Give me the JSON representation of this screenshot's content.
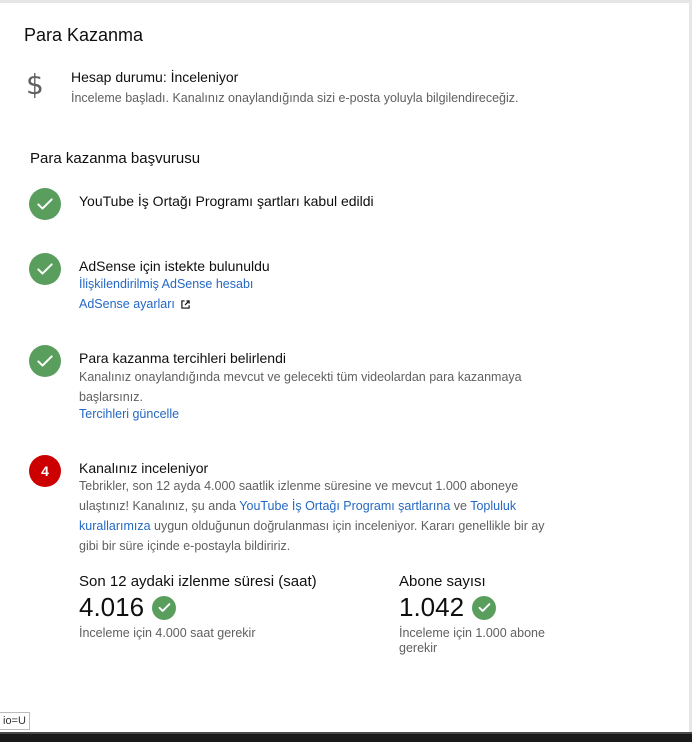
{
  "page": {
    "title": "Para Kazanma"
  },
  "account_status": {
    "icon": "dollar-icon",
    "title": "Hesap durumu: İnceleniyor",
    "description": "İnceleme başladı. Kanalınız onaylandığında sizi e-posta yoluyla bilgilendireceğiz."
  },
  "application": {
    "title": "Para kazanma başvurusu",
    "steps": [
      {
        "status": "done",
        "title": "YouTube İş Ortağı Programı şartları kabul edildi"
      },
      {
        "status": "done",
        "title": "AdSense için istekte bulunuldu",
        "link1": "İlişkilendirilmiş AdSense hesabı",
        "link2": "AdSense ayarları"
      },
      {
        "status": "done",
        "title": "Para kazanma tercihleri belirlendi",
        "description": "Kanalınız onaylandığında mevcut ve gelecekti tüm videolardan para kazanmaya başlarsınız.",
        "link": "Tercihleri güncelle"
      },
      {
        "status": "in-progress",
        "number": "4",
        "title": "Kanalınız inceleniyor",
        "desc_part1": "Tebrikler, son 12 ayda 4.000 saatlik izlenme süresine ve mevcut 1.000 aboneye ulaştınız! Kanalınız, şu anda ",
        "desc_link1": "YouTube İş Ortağı Programı şartlarına",
        "desc_part2": " ve ",
        "desc_link2": "Topluluk kurallarımıza",
        "desc_part3": " uygun olduğunun doğrulanması için inceleniyor. Kararı genellikle bir ay gibi bir süre içinde e-postayla bildiririz."
      }
    ]
  },
  "metrics": [
    {
      "label": "Son 12 aydaki izlenme süresi (saat)",
      "value": "4.016",
      "note": "İnceleme için 4.000 saat gerekir"
    },
    {
      "label": "Abone sayısı",
      "value": "1.042",
      "note": "İnceleme için 1.000 abone gerekir"
    }
  ],
  "corner_tag": "io=U",
  "colors": {
    "success": "#5a9e5e",
    "pending": "#cc0000",
    "link": "#2468c4",
    "muted": "#606060"
  }
}
